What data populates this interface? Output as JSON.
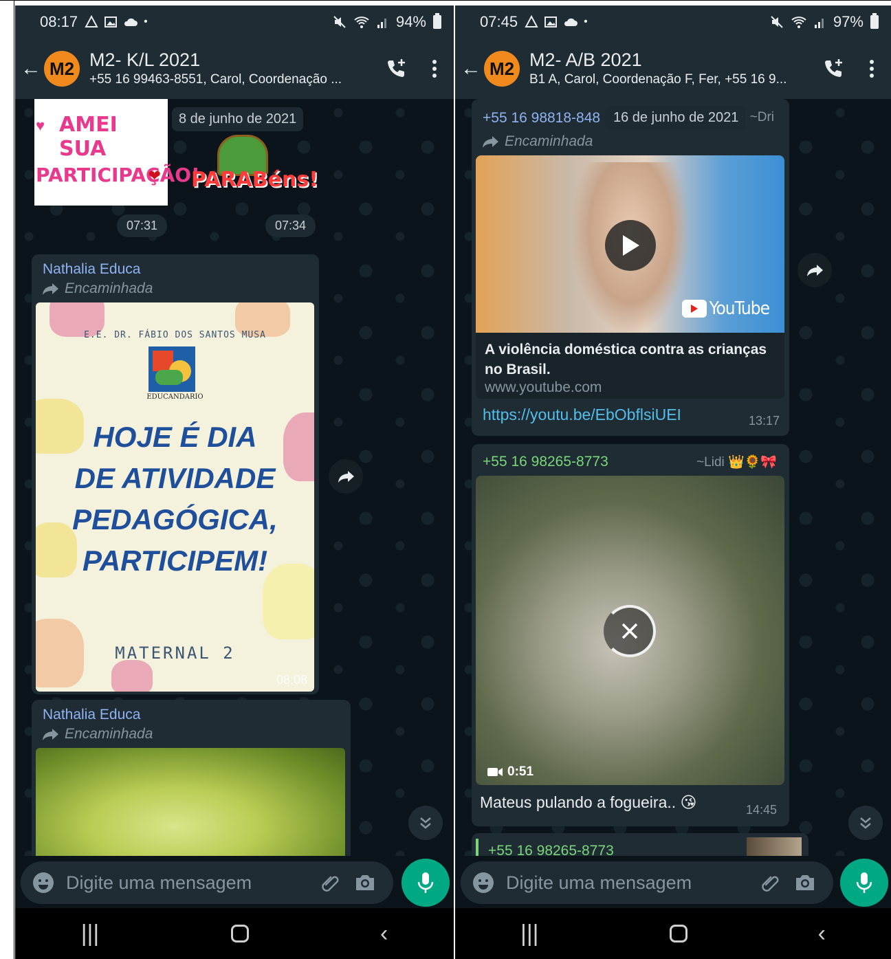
{
  "left": {
    "status": {
      "time": "08:17",
      "battery": "94%"
    },
    "header": {
      "avatar": "M2",
      "title": "M2- K/L 2021",
      "subtitle": "+55 16 99463-8551, Carol, Coordenação ..."
    },
    "date_chip": "8 de junho de 2021",
    "sticker1": {
      "line1": "AMEI SUA",
      "line2": "PARTICIPAÇÃO!"
    },
    "sticker2": {
      "text": "PARABéns!"
    },
    "sticker_times": [
      "07:31",
      "07:34"
    ],
    "msg1": {
      "sender": "Nathalia Educa",
      "forwarded": "Encaminhada",
      "poster": {
        "school": "E.E. DR. FÁBIO DOS SANTOS MUSA",
        "logo_caption": "EDUCANDARIO",
        "line1": "HOJE É DIA",
        "line2": "DE ATIVIDADE",
        "line3": "PEDAGÓGICA,",
        "line4": "PARTICIPEM!",
        "footer": "MATERNAL 2"
      },
      "time": "08:08"
    },
    "msg2": {
      "sender": "Nathalia Educa",
      "forwarded": "Encaminhada"
    },
    "input_placeholder": "Digite uma mensagem"
  },
  "right": {
    "status": {
      "time": "07:45",
      "battery": "97%"
    },
    "header": {
      "avatar": "M2",
      "title": "M2- A/B 2021",
      "subtitle": "B1 A, Carol, Coordenação F, Fer, +55 16 9..."
    },
    "msg1": {
      "sender": "+55 16 98818-848",
      "date_chip": "16 de junho de 2021",
      "alias": "~Dri",
      "forwarded": "Encaminhada",
      "youtube_badge": "YouTube",
      "preview_title": "A violência doméstica contra as crianças no Brasil.",
      "preview_domain": "www.youtube.com",
      "link": "https://youtu.be/EbObflsiUEI",
      "time": "13:17"
    },
    "msg2": {
      "sender": "+55 16 98265-8773",
      "alias": "~Lidi 👑🌻🎀",
      "video_duration": "0:51",
      "caption": "Mateus pulando a fogueira.. 😘",
      "time": "14:45"
    },
    "msg3": {
      "sender": "+55 16 98265-8773"
    },
    "input_placeholder": "Digite uma mensagem"
  },
  "colors": {
    "bg": "#0b141a",
    "bar": "#1f2c33",
    "bubble": "#202c33",
    "accent": "#00a884",
    "avatar": "#f08a1c",
    "link": "#53bdeb"
  }
}
